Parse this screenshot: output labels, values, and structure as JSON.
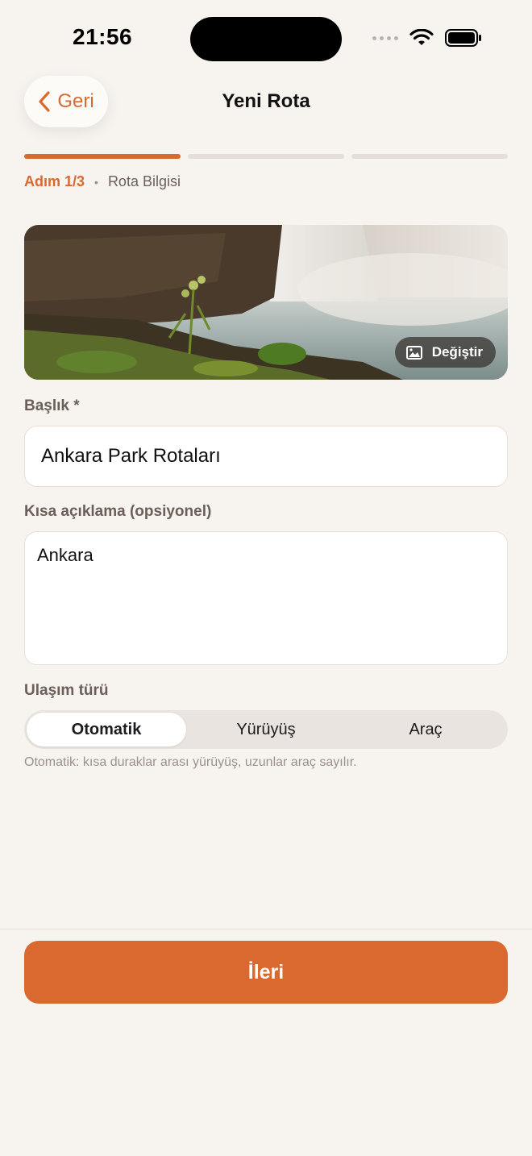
{
  "status_bar": {
    "time": "21:56"
  },
  "nav": {
    "back_label": "Geri",
    "title": "Yeni Rota"
  },
  "progress": {
    "current_step": 1,
    "total_steps": 3,
    "step_label": "Adım 1/3",
    "step_name": "Rota Bilgisi"
  },
  "cover": {
    "change_label": "Değiştir"
  },
  "form": {
    "title_label": "Başlık *",
    "title_value": "Ankara Park Rotaları",
    "description_label": "Kısa açıklama (opsiyonel)",
    "description_value": "Ankara",
    "transport_label": "Ulaşım türü",
    "transport_options": [
      "Otomatik",
      "Yürüyüş",
      "Araç"
    ],
    "transport_selected": "Otomatik",
    "transport_hint": "Otomatik: kısa duraklar arası yürüyüş, uzunlar araç sayılır."
  },
  "footer": {
    "next_label": "İleri"
  },
  "colors": {
    "accent": "#D9692E",
    "background": "#F7F3EF"
  }
}
